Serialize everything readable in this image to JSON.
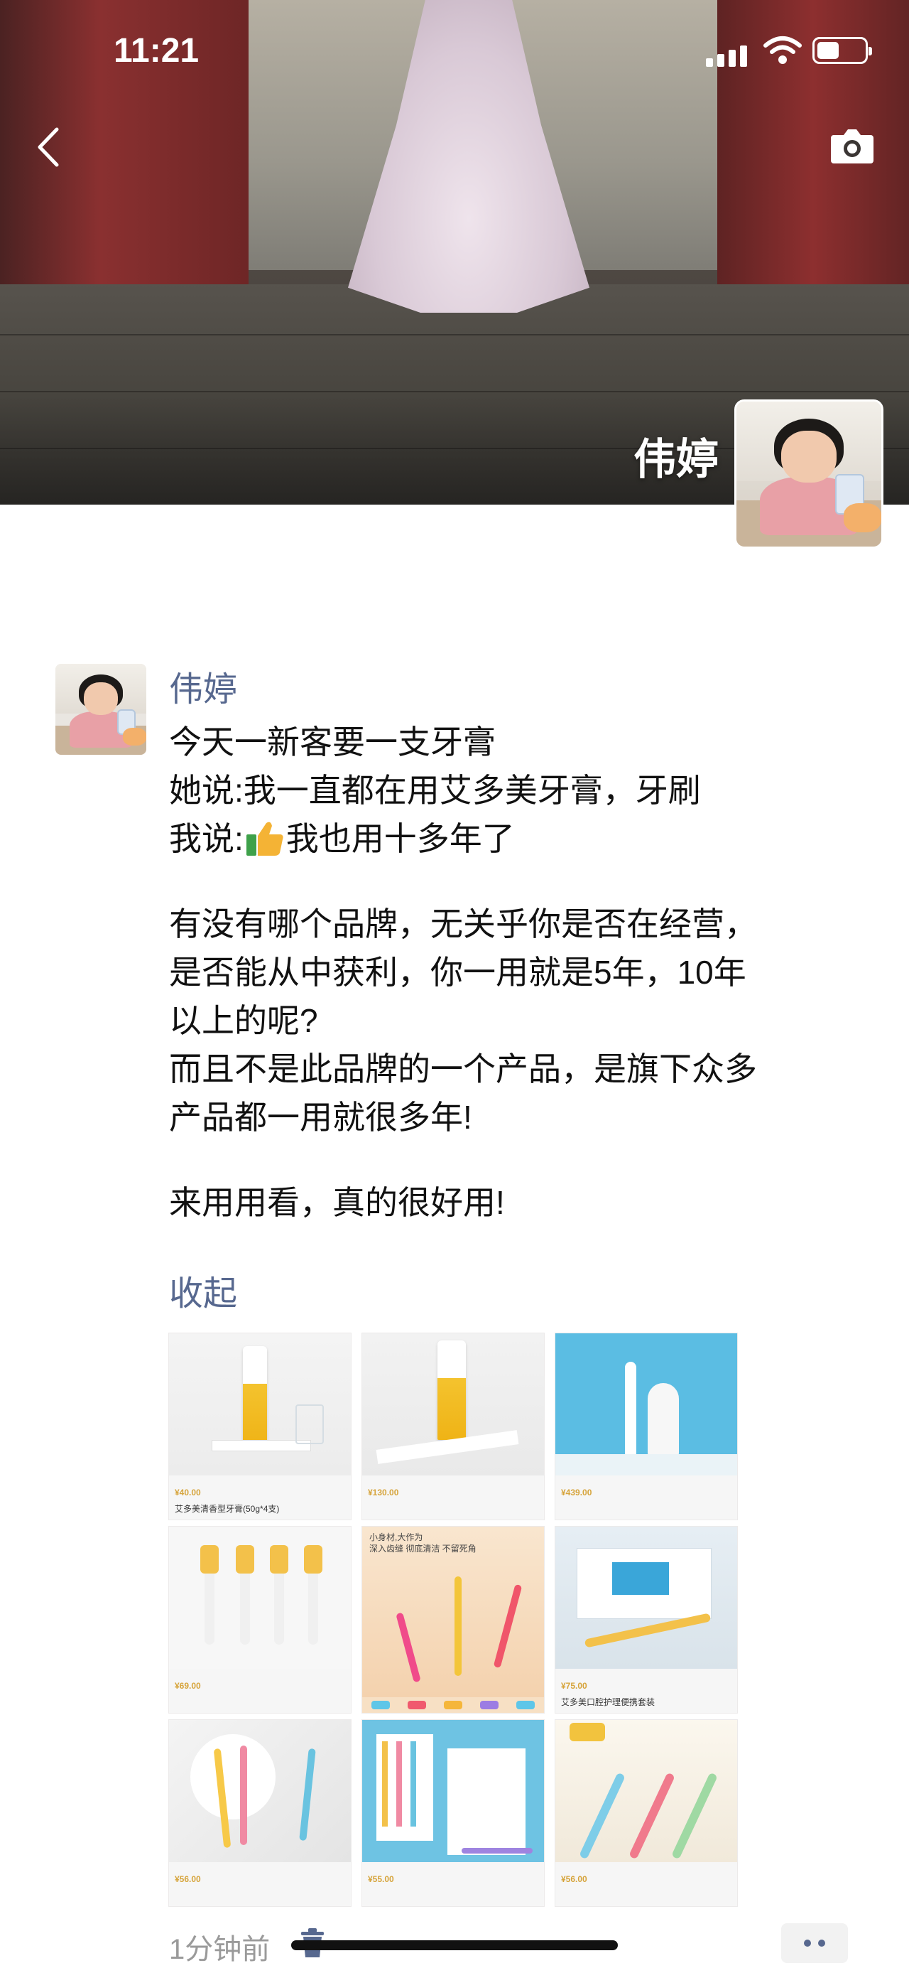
{
  "status_bar": {
    "time": "11:21"
  },
  "cover": {
    "name": "伟婷",
    "back_icon": "chevron-left-icon",
    "camera_icon": "camera-icon"
  },
  "post": {
    "author": "伟婷",
    "lines": [
      "今天一新客要一支牙膏",
      "她说:我一直都在用艾多美牙膏，牙刷",
      "我说:",
      "我也用十多年了",
      "有没有哪个品牌，无关乎你是否在经营，",
      "是否能从中获利，你一用就是5年，10年",
      "以上的呢?",
      "而且不是此品牌的一个产品，是旗下众多",
      "产品都一用就很多年!",
      "来用用看，真的很好用!"
    ],
    "collapse_label": "收起",
    "time": "1分钟前",
    "images": [
      {
        "price": "¥40.00",
        "name": "艾多美清香型牙膏(50g*4支)"
      },
      {
        "price": "¥130.00",
        "name": ""
      },
      {
        "price": "¥439.00",
        "name": ""
      },
      {
        "price": "¥69.00",
        "name": ""
      },
      {
        "price": "",
        "name": "",
        "banner_lines": [
          "小身材,大作为",
          "深入齿缝 彻底清洁 不留死角"
        ]
      },
      {
        "price": "¥75.00",
        "name": "艾多美口腔护理便携套装"
      },
      {
        "price": "¥56.00",
        "name": ""
      },
      {
        "price": "¥55.00",
        "name": ""
      },
      {
        "price": "¥56.00",
        "name": ""
      }
    ]
  },
  "colors": {
    "link": "#57688f",
    "price": "#d6a43b"
  }
}
